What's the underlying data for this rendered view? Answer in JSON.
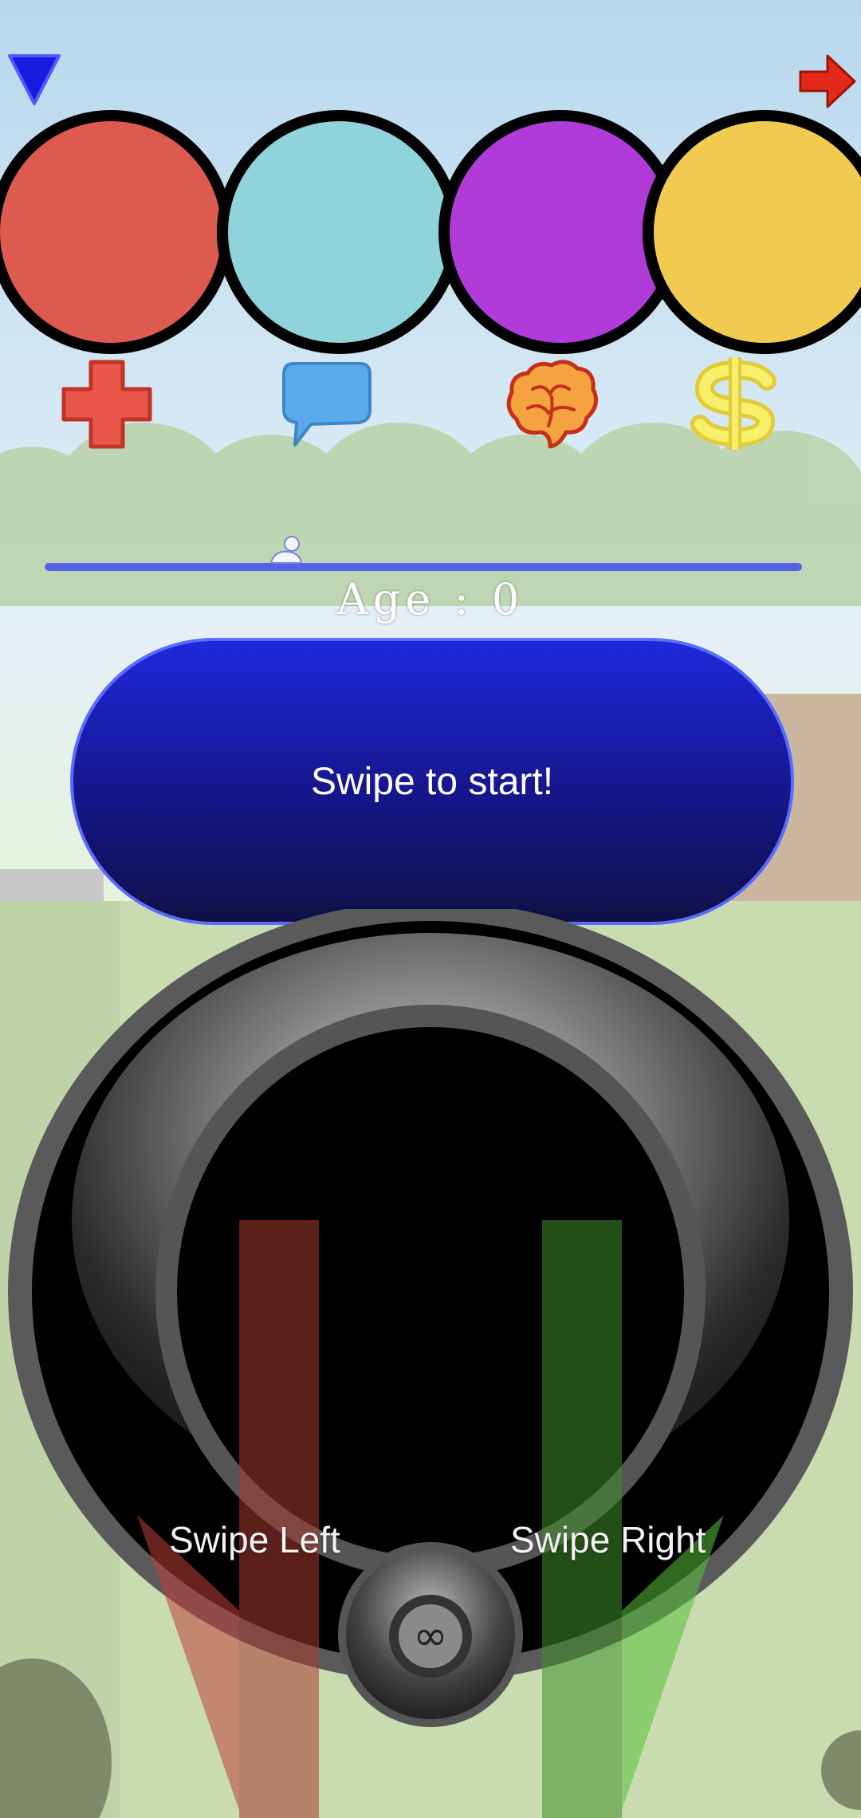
{
  "top_bar": {
    "menu_icon": "blue-down-triangle",
    "next_icon": "red-right-arrow"
  },
  "stats": [
    {
      "name": "health",
      "icon": "red-cross-icon",
      "color": "#dc5a4e"
    },
    {
      "name": "social",
      "icon": "speech-bubble-icon",
      "color": "#8fd3db"
    },
    {
      "name": "intelligence",
      "icon": "brain-icon",
      "color": "#b03bd9"
    },
    {
      "name": "money",
      "icon": "dollar-icon",
      "color": "#f1cb4f"
    }
  ],
  "age_bar": {
    "age_text": "Age : 0",
    "progress": 0.3
  },
  "start_button": {
    "label": "Swipe to start!"
  },
  "controls": {
    "swipe_left_label": "Swipe Left",
    "swipe_right_label": "Swipe Right",
    "center_icon": "infinity-icon",
    "infinity_glyph": "∞"
  },
  "colors": {
    "sky_top": "#b9d9ee",
    "health": "#dc5a4e",
    "social": "#8fd3db",
    "intelligence": "#b03bd9",
    "money": "#f1cb4f",
    "age_bar": "#5562e8",
    "left_arrow": "#c0403a",
    "right_arrow": "#58c23a"
  }
}
